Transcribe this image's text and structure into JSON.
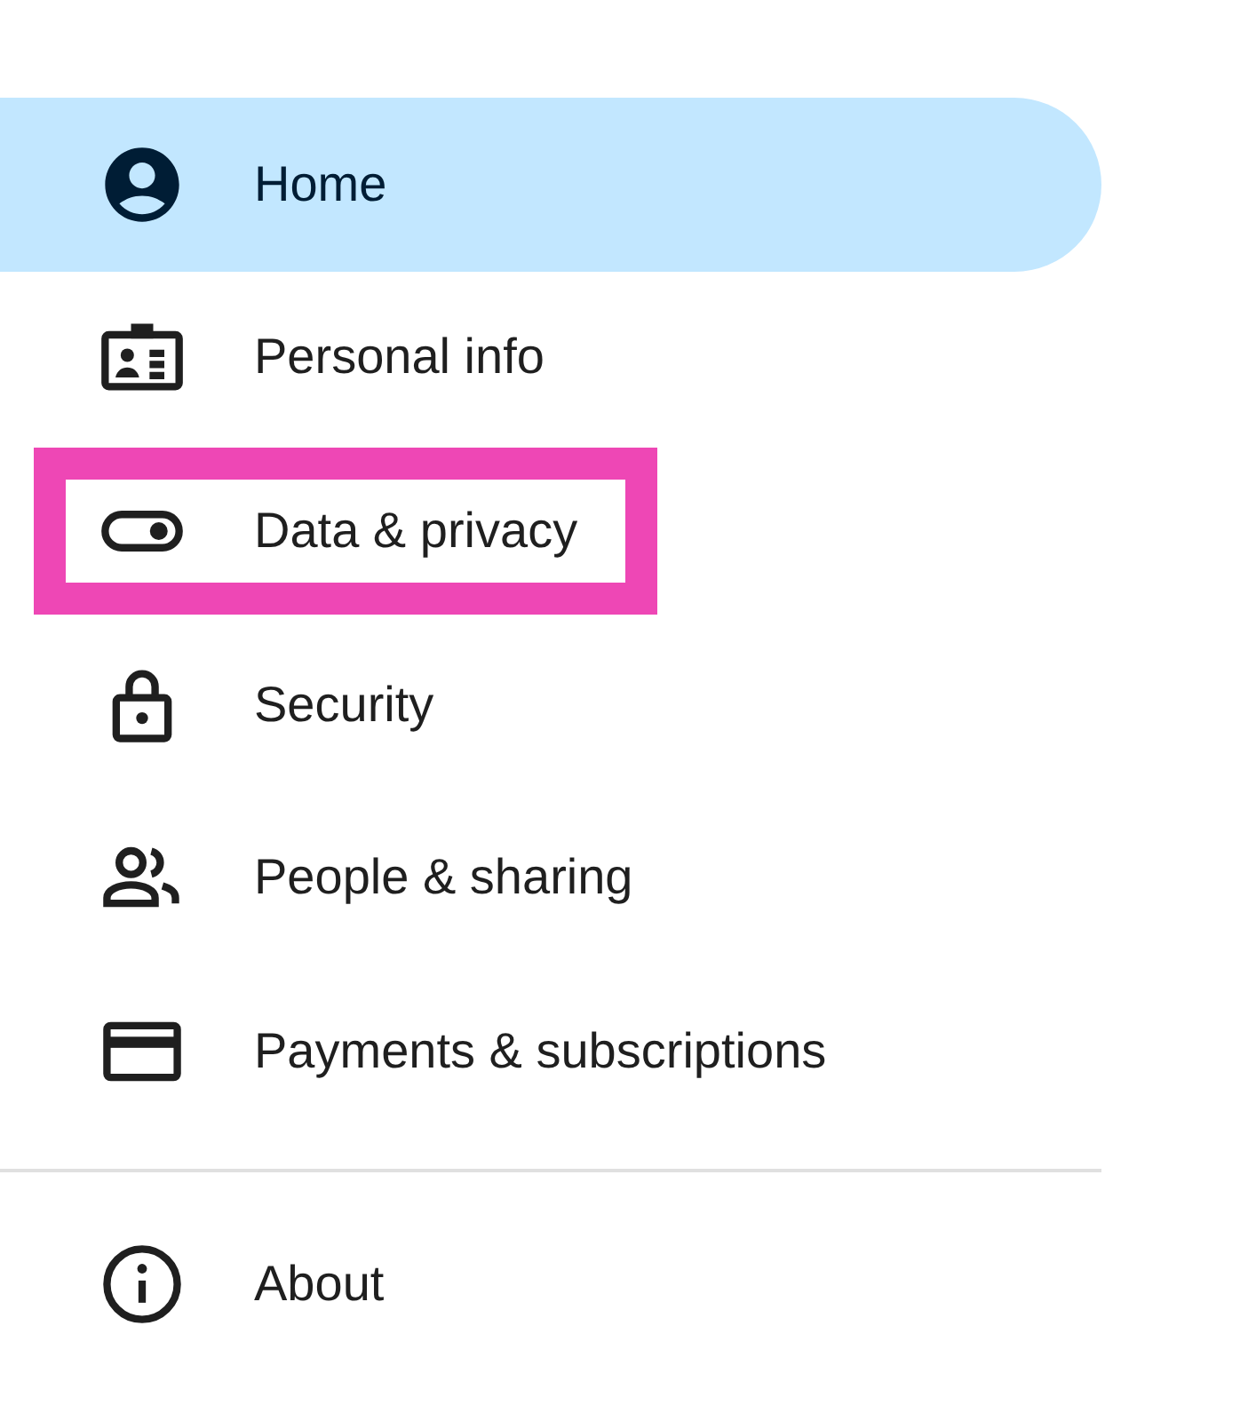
{
  "nav": {
    "items": [
      {
        "label": "Home",
        "selected": true,
        "highlighted": false
      },
      {
        "label": "Personal info",
        "selected": false,
        "highlighted": false
      },
      {
        "label": "Data & privacy",
        "selected": false,
        "highlighted": true
      },
      {
        "label": "Security",
        "selected": false,
        "highlighted": false
      },
      {
        "label": "People & sharing",
        "selected": false,
        "highlighted": false
      },
      {
        "label": "Payments & subscriptions",
        "selected": false,
        "highlighted": false
      }
    ]
  },
  "footer": {
    "items": [
      {
        "label": "About",
        "selected": false,
        "highlighted": false
      }
    ]
  }
}
